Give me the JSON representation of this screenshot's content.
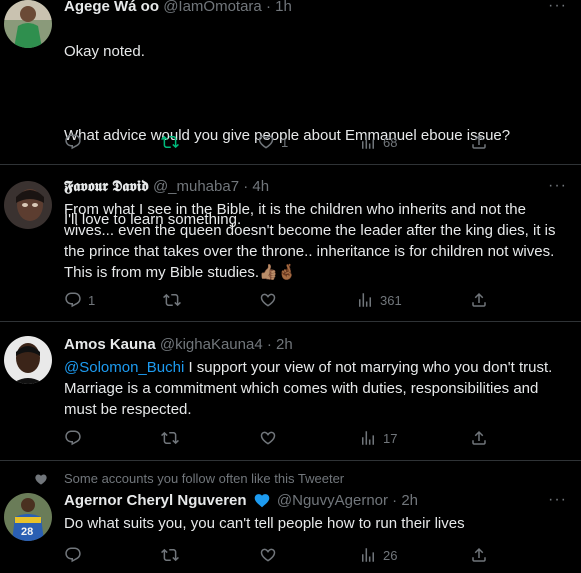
{
  "tweets": [
    {
      "name": "Agege Wá oo",
      "handle": "@IamOmotara",
      "dot": "·",
      "time": "1h",
      "text_lines": [
        "Okay noted.",
        "",
        "What advice would you give people about Emmanuel eboue issue?",
        "",
        "I'll love to learn something."
      ],
      "replies": "",
      "retweets": "",
      "likes": "1",
      "views": "68",
      "retweet_color": "#00ba7c"
    },
    {
      "name": "𝕱𝖆𝖛𝖔𝖚𝖗 𝕯𝖆𝖛𝖎𝖉",
      "handle": "@_muhaba7",
      "dot": "·",
      "time": "4h",
      "text": "From what I see in the Bible, it is the children who inherits and not the wives...  even the queen doesn't become the leader after the king dies, it is the prince that takes over the throne.. inheritance is for children not wives.   This is from my Bible studies.👍🏽🤞🏾",
      "replies": "1",
      "retweets": "",
      "likes": "",
      "views": "361"
    },
    {
      "name": "Amos Kauna",
      "handle": "@kighaKauna4",
      "dot": "·",
      "time": "2h",
      "mention": "@Solomon_Buchi",
      "text": " I support your view of not marrying who you don't trust. Marriage is a commitment which comes with duties,  responsibilities and must be respected.",
      "replies": "",
      "retweets": "",
      "likes": "",
      "views": "17"
    },
    {
      "social_context": "Some accounts you follow often like this Tweeter",
      "name": "Agernor Cheryl Nguveren",
      "handle": "@NguvyAgernor",
      "dot": "·",
      "time": "2h",
      "text": "Do what suits you, you can't tell people how to run their lives",
      "replies": "",
      "retweets": "",
      "likes": "",
      "views": "26",
      "verified_color": "#1d9bf0"
    }
  ],
  "more_label": "···",
  "avatar_labels": {
    "t4_jersey": "28"
  },
  "icons": [
    "reply-icon",
    "retweet-icon",
    "like-icon",
    "views-icon",
    "share-icon",
    "more-icon",
    "verified-heart-icon"
  ]
}
